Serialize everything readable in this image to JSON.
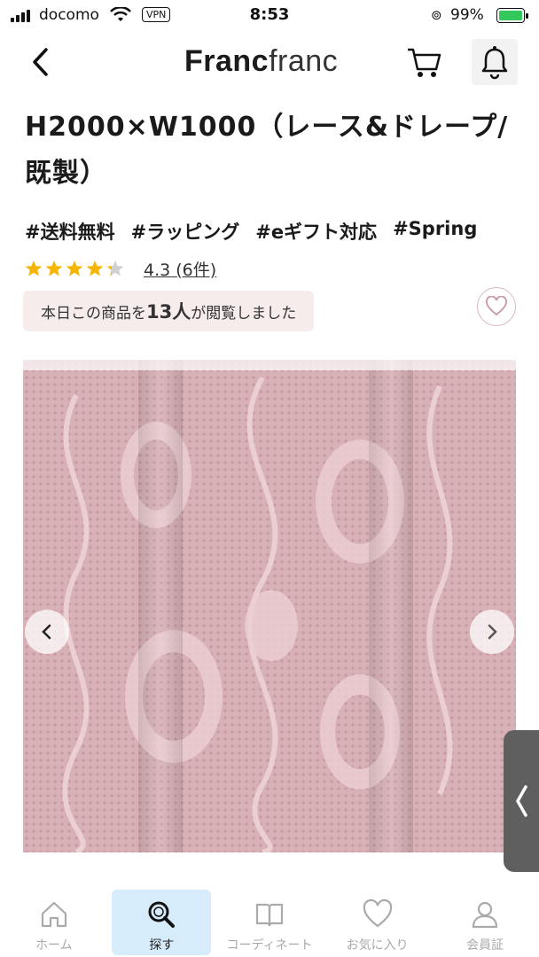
{
  "status_bar": {
    "carrier": "docomo",
    "vpn": "VPN",
    "time": "8:53",
    "battery": "99%"
  },
  "header": {
    "brand_bold": "Franc",
    "brand_light": "franc"
  },
  "product": {
    "title": "H2000×W1000（レース&ドレープ/既製）",
    "tags": [
      "#送料無料",
      "#ラッピング",
      "#eギフト対応",
      "#Spring"
    ],
    "rating_value": 4.3,
    "rating_text": "4.3",
    "review_count": "(6件)",
    "viewed_prefix": "本日この商品を",
    "viewed_count": "13人",
    "viewed_suffix": "が閲覧しました"
  },
  "colors": {
    "accent_pink": "#f7ecec",
    "star": "#f5b500",
    "active_tab_bg": "#d6ecfb"
  },
  "tabbar": [
    {
      "label": "ホーム",
      "icon": "home-icon",
      "active": false
    },
    {
      "label": "探す",
      "icon": "search-icon",
      "active": true
    },
    {
      "label": "コーディネート",
      "icon": "book-icon",
      "active": false
    },
    {
      "label": "お気に入り",
      "icon": "heart-icon",
      "active": false
    },
    {
      "label": "会員証",
      "icon": "member-icon",
      "active": false
    }
  ]
}
